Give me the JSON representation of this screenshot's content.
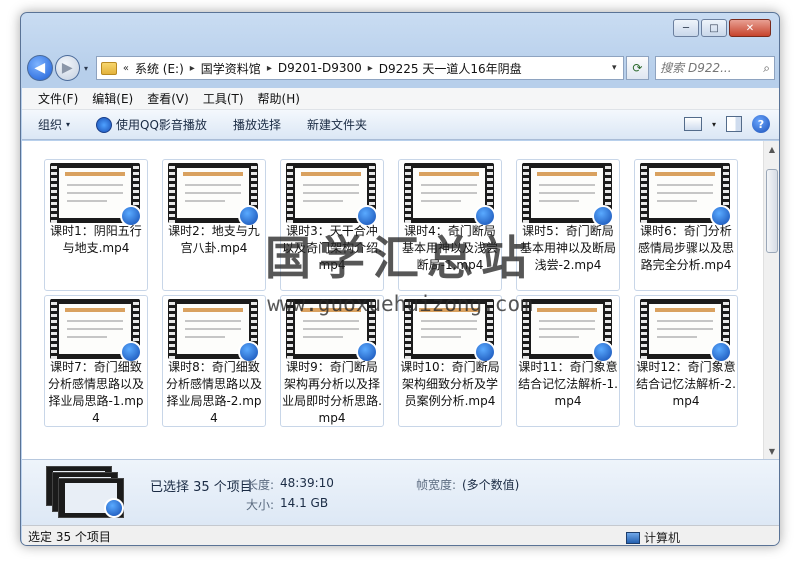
{
  "window": {
    "caption_minimize": "─",
    "caption_maximize": "□",
    "caption_close": "✕"
  },
  "nav": {
    "back_glyph": "◀",
    "forward_glyph": "▶",
    "dropdown_glyph": "▾"
  },
  "address": {
    "overflow": "«",
    "separator": "▸",
    "crumbs": [
      "系统 (E:)",
      "国学资料馆",
      "D9201-D9300",
      "D9225 天一道人16年阴盘"
    ],
    "dropdown_glyph": "▾",
    "refresh_glyph": "⟳"
  },
  "search": {
    "placeholder": "搜索 D922...",
    "icon": "search-icon",
    "glyph": "⌕"
  },
  "menu": [
    "文件(F)",
    "编辑(E)",
    "查看(V)",
    "工具(T)",
    "帮助(H)"
  ],
  "toolbar": {
    "organize": "组织",
    "play_qq": "使用QQ影音播放",
    "play_selection": "播放选择",
    "new_folder": "新建文件夹",
    "caret": "▾",
    "help_glyph": "?"
  },
  "files": [
    {
      "name": "课时1：阴阳五行与地支.mp4"
    },
    {
      "name": "课时2：地支与九宫八卦.mp4"
    },
    {
      "name": "课时3：天干合冲以及奇门架构介绍.mp4"
    },
    {
      "name": "课时4：奇门断局基本用神以及浅尝断局-1.mp4"
    },
    {
      "name": "课时5：奇门断局基本用神以及断局浅尝-2.mp4"
    },
    {
      "name": "课时6：奇门分析感情局步骤以及思路完全分析.mp4"
    },
    {
      "name": "课时7：奇门细致分析感情思路以及择业局思路-1.mp4"
    },
    {
      "name": "课时8：奇门细致分析感情思路以及择业局思路-2.mp4"
    },
    {
      "name": "课时9：奇门断局架构再分析以及择业局即时分析思路.mp4"
    },
    {
      "name": "课时10：奇门断局架构细致分析及学员案例分析.mp4"
    },
    {
      "name": "课时11：奇门象意结合记忆法解析-1.mp4"
    },
    {
      "name": "课时12：奇门象意结合记忆法解析-2.mp4"
    }
  ],
  "scroll": {
    "up": "▲",
    "down": "▼"
  },
  "watermark": {
    "title": "国学汇总站",
    "url": "www.guoxuehuizong.com"
  },
  "details": {
    "selected": "已选择 35 个项目",
    "length_label": "长度:",
    "length_value": "48:39:10",
    "size_label": "大小:",
    "size_value": "14.1 GB",
    "frame_width_label": "帧宽度:",
    "frame_width_value": "(多个数值)"
  },
  "status": {
    "text": "选定 35 个项目",
    "location": "计算机"
  }
}
